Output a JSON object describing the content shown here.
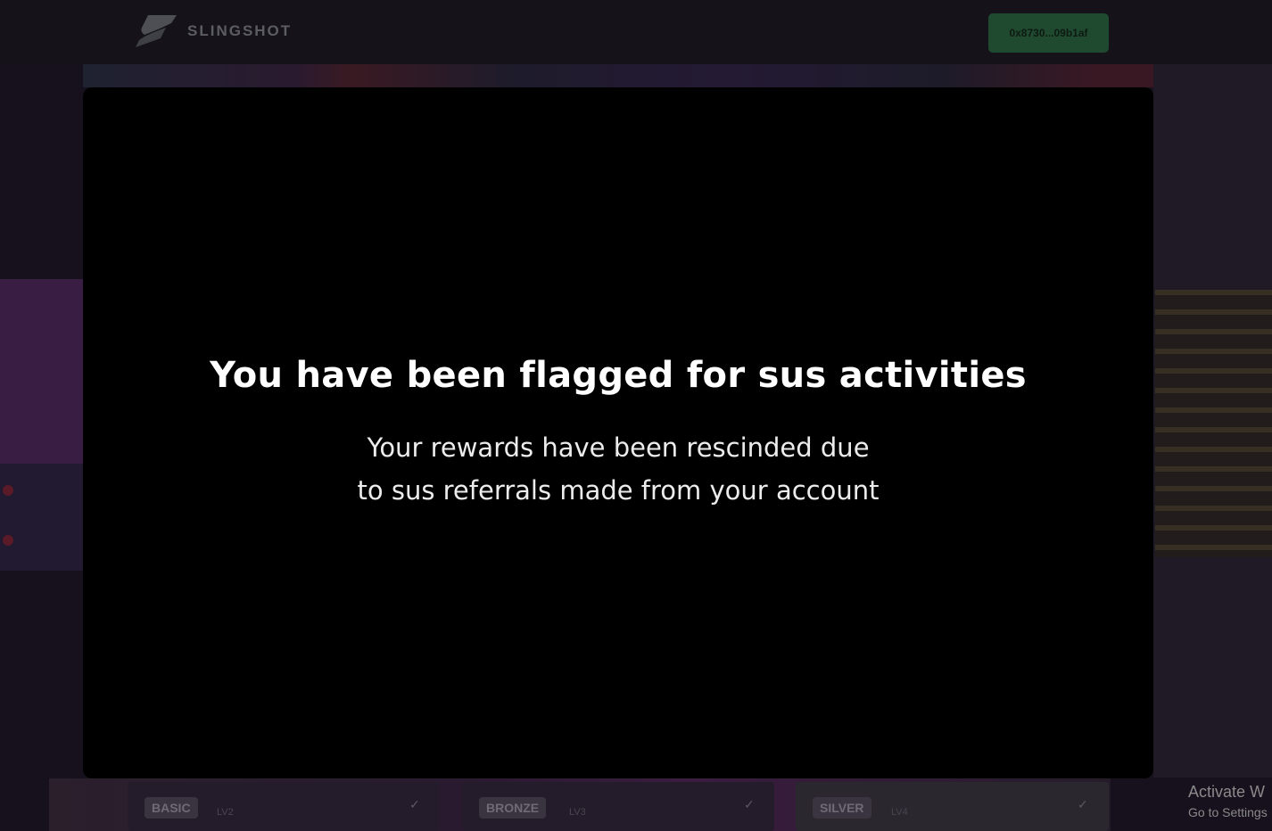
{
  "header": {
    "brand": "SLINGSHOT",
    "wallet_address": "0x8730...09b1af"
  },
  "modal": {
    "title": "You have been flagged for sus activities",
    "message_line1": "Your rewards have been rescinded due",
    "message_line2": "to sus referrals made from your account"
  },
  "tiers": [
    {
      "name": "BASIC",
      "level": "LV2"
    },
    {
      "name": "BRONZE",
      "level": "LV3"
    },
    {
      "name": "SILVER",
      "level": "LV4"
    }
  ],
  "watermark": {
    "line1": "Activate W",
    "line2": "Go to Settings"
  },
  "colors": {
    "modal_bg": "#000000",
    "wallet_button": "#1f4a30",
    "page_bg": "#16111c"
  }
}
